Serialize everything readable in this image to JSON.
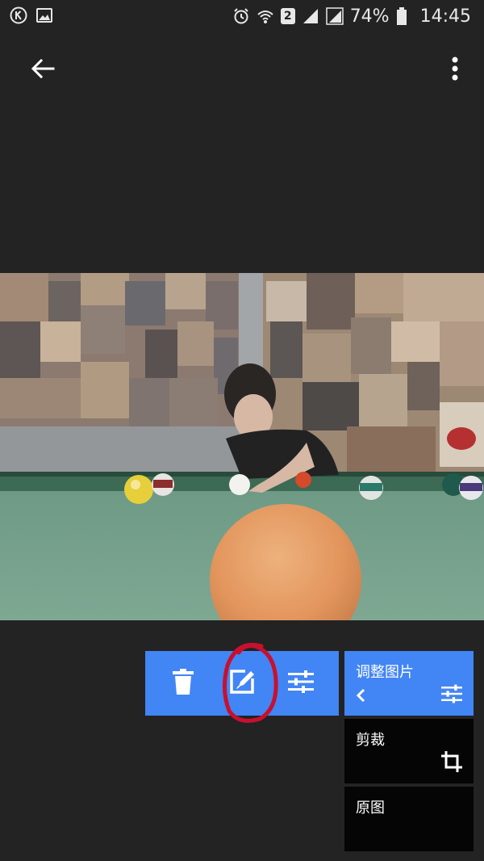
{
  "status_bar": {
    "left_icons": [
      "k-app-icon",
      "gallery-notification-icon"
    ],
    "right_icons": [
      "alarm-icon",
      "wifi-icon",
      "sim2-badge",
      "signal-icon",
      "signal-icon"
    ],
    "sim_label": "2",
    "battery_percent": "74%",
    "time": "14:45"
  },
  "toolbar": {
    "back_icon": "arrow-back-icon",
    "more_icon": "more-vert-icon"
  },
  "action_bar": {
    "buttons": [
      {
        "name": "delete",
        "icon": "trash-icon"
      },
      {
        "name": "edit",
        "icon": "edit-photo-icon"
      },
      {
        "name": "adjust",
        "icon": "tune-icon"
      }
    ],
    "color": "#4285f4"
  },
  "edit_menu": {
    "items": [
      {
        "label": "调整图片",
        "icon": "tune-icon",
        "active": true
      },
      {
        "label": "剪裁",
        "icon": "crop-icon",
        "active": false
      },
      {
        "label": "原图",
        "icon": "",
        "active": false
      }
    ]
  },
  "annotation": {
    "color": "#c8102e",
    "target": "edit-button"
  }
}
